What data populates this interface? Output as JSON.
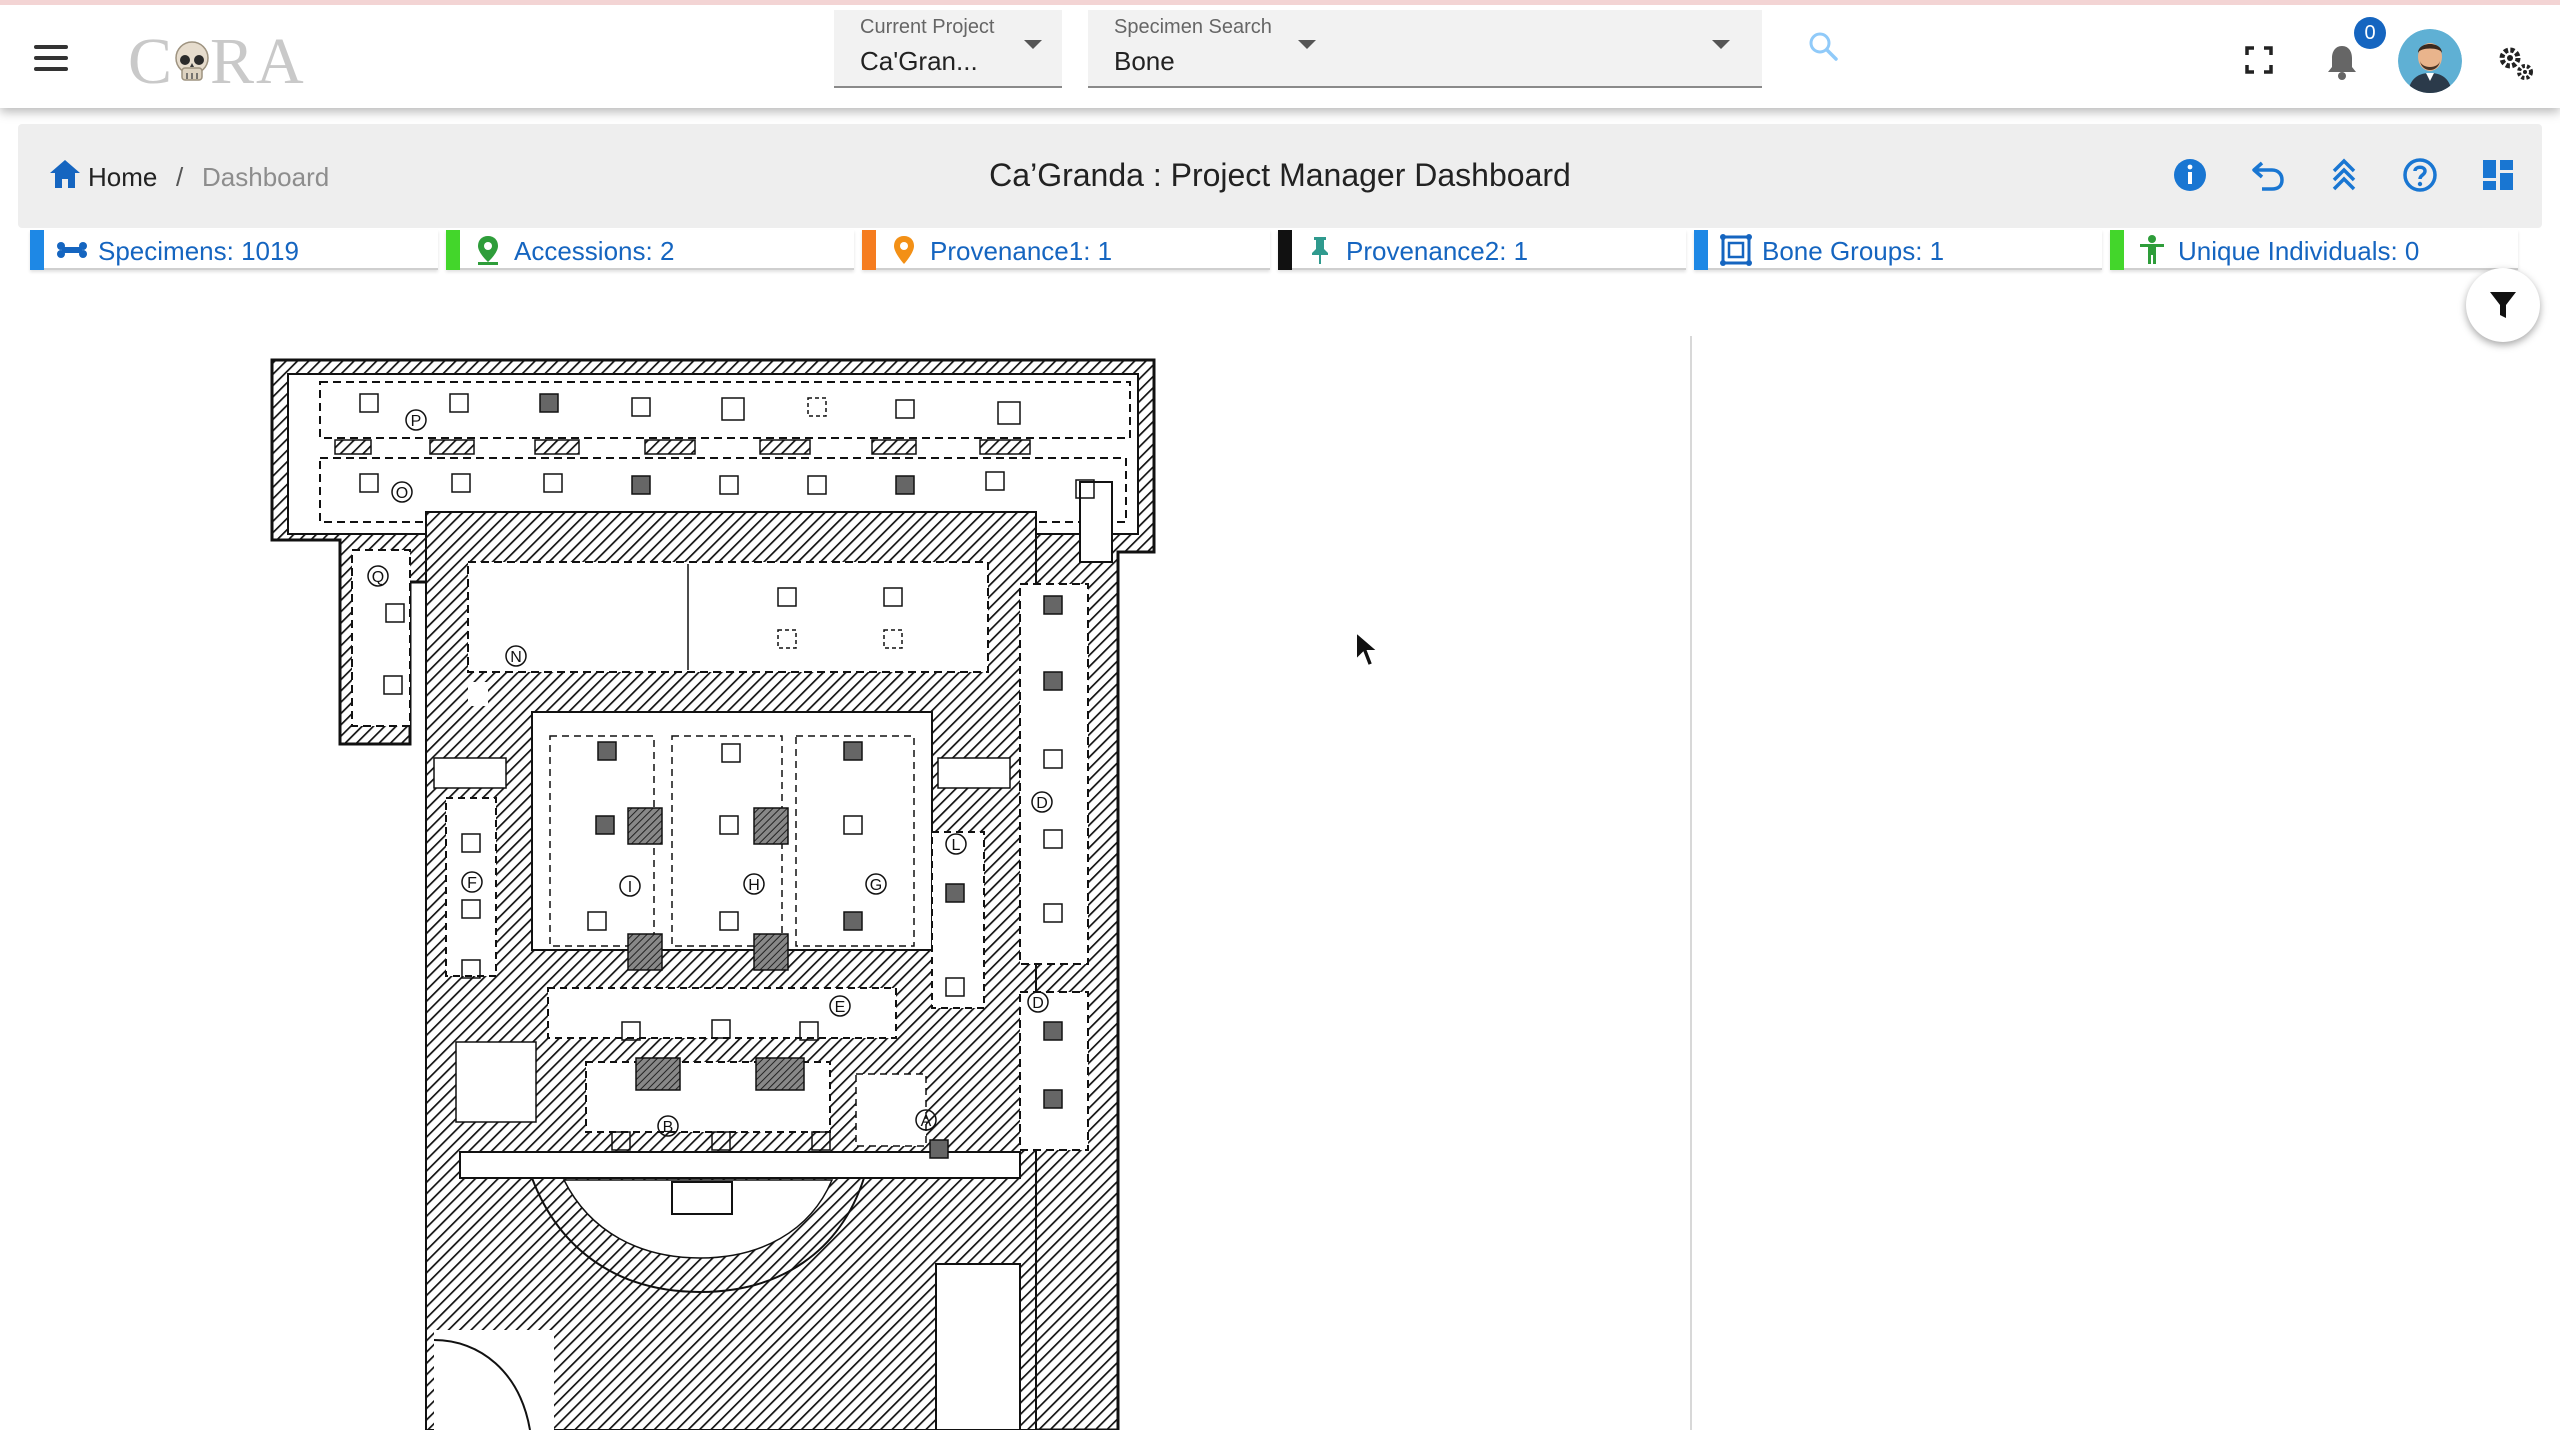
{
  "app": {
    "logo_text_left": "C",
    "logo_text_right": "RA",
    "current_project": {
      "label": "Current Project",
      "value": "Ca'Gran..."
    },
    "specimen_search": {
      "label": "Specimen Search",
      "value": "Bone"
    },
    "notification_count": "0"
  },
  "breadcrumb": {
    "home": "Home",
    "separator": "/",
    "current": "Dashboard"
  },
  "page_title": "Ca’Granda : Project Manager Dashboard",
  "stats": [
    {
      "label": "Specimens: 1019",
      "color": "#1e88e5",
      "icon": "bone-icon"
    },
    {
      "label": "Accessions: 2",
      "color": "#43d62b",
      "icon": "map-pin-icon"
    },
    {
      "label": "Provenance1: 1",
      "color": "#f57c1f",
      "icon": "location-pin-icon"
    },
    {
      "label": "Provenance2: 1",
      "color": "#111111",
      "icon": "push-pin-icon"
    },
    {
      "label": "Bone Groups: 1",
      "color": "#1e88e5",
      "icon": "bone-group-icon"
    },
    {
      "label": "Unique Individuals: 0",
      "color": "#43d62b",
      "icon": "person-icon"
    }
  ],
  "colors": {
    "accent": "#1565c0",
    "icon_blue": "#1976d2"
  },
  "floor_plan": {
    "markers": [
      "P",
      "O",
      "Q",
      "N",
      "I",
      "H",
      "G",
      "F",
      "L",
      "D",
      "D",
      "E",
      "B",
      "A"
    ],
    "crypts": [
      "c001",
      "c002",
      "c003",
      "c004",
      "c005",
      "c006",
      "c007",
      "c008",
      "c009",
      "c010",
      "c011",
      "c012",
      "c013",
      "c014",
      "c015",
      "c016",
      "c017",
      "c018",
      "c019",
      "c020",
      "c021",
      "c022",
      "c023",
      "c024",
      "c025",
      "c026",
      "c027",
      "c028",
      "c029",
      "c030",
      "c031",
      "c032",
      "c033",
      "c034",
      "c035",
      "c036",
      "c037",
      "c038",
      "c039",
      "c040",
      "c041",
      "c042",
      "c043",
      "c044",
      "c045",
      "c046",
      "c047",
      "c048",
      "c049",
      "c050",
      "c051",
      "c052"
    ]
  }
}
